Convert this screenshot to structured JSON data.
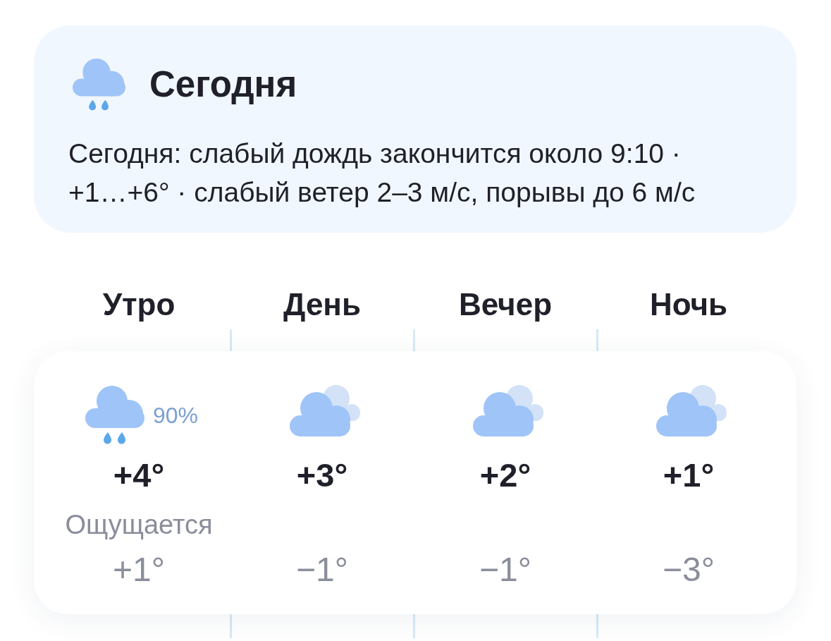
{
  "today": {
    "kind": "rain",
    "title": "Сегодня",
    "summary": "Сегодня: слабый дождь закончится около 9:10 · +1…+6° · слабый ветер 2–3 м/с, порывы до 6 м/с"
  },
  "periods": [
    {
      "label": "Утро",
      "kind": "rain",
      "precipitation": "90%",
      "temperature": "+4°",
      "feels_like_label": "Ощущается",
      "feels_like": "+1°"
    },
    {
      "label": "День",
      "kind": "cloudy",
      "temperature": "+3°",
      "feels_like": "−1°"
    },
    {
      "label": "Вечер",
      "kind": "cloudy",
      "temperature": "+2°",
      "feels_like": "−1°"
    },
    {
      "label": "Ночь",
      "kind": "cloudy",
      "temperature": "+1°",
      "feels_like": "−3°"
    }
  ]
}
